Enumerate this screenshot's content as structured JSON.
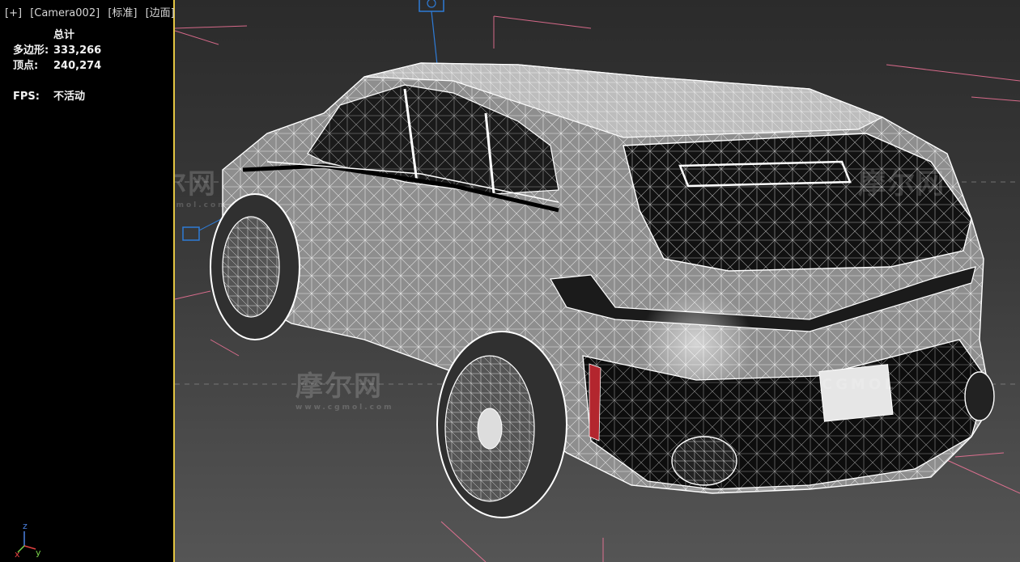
{
  "viewport": {
    "labels": [
      "[+]",
      "[Camera002]",
      "[标准]",
      "[边面]"
    ]
  },
  "stats": {
    "heading": "总计",
    "rows": [
      {
        "key": "多边形:",
        "value": "333,266"
      },
      {
        "key": "顶点:",
        "value": "240,274"
      }
    ],
    "fps_key": "FPS:",
    "fps_value": "不活动"
  },
  "watermark": {
    "cn": "摩尔网",
    "en": "CGMOL",
    "url": "www.cgmol.com"
  },
  "axes": {
    "x": "x",
    "y": "y",
    "z": "z"
  },
  "colors": {
    "panel_border": "#e3c542",
    "wire": "#ffffff",
    "camera_line": "#ff78a0",
    "gizmo_blue": "#2e7bd6",
    "axis_x": "#e04040",
    "axis_y": "#7ad24a",
    "axis_z": "#4a80e0"
  }
}
